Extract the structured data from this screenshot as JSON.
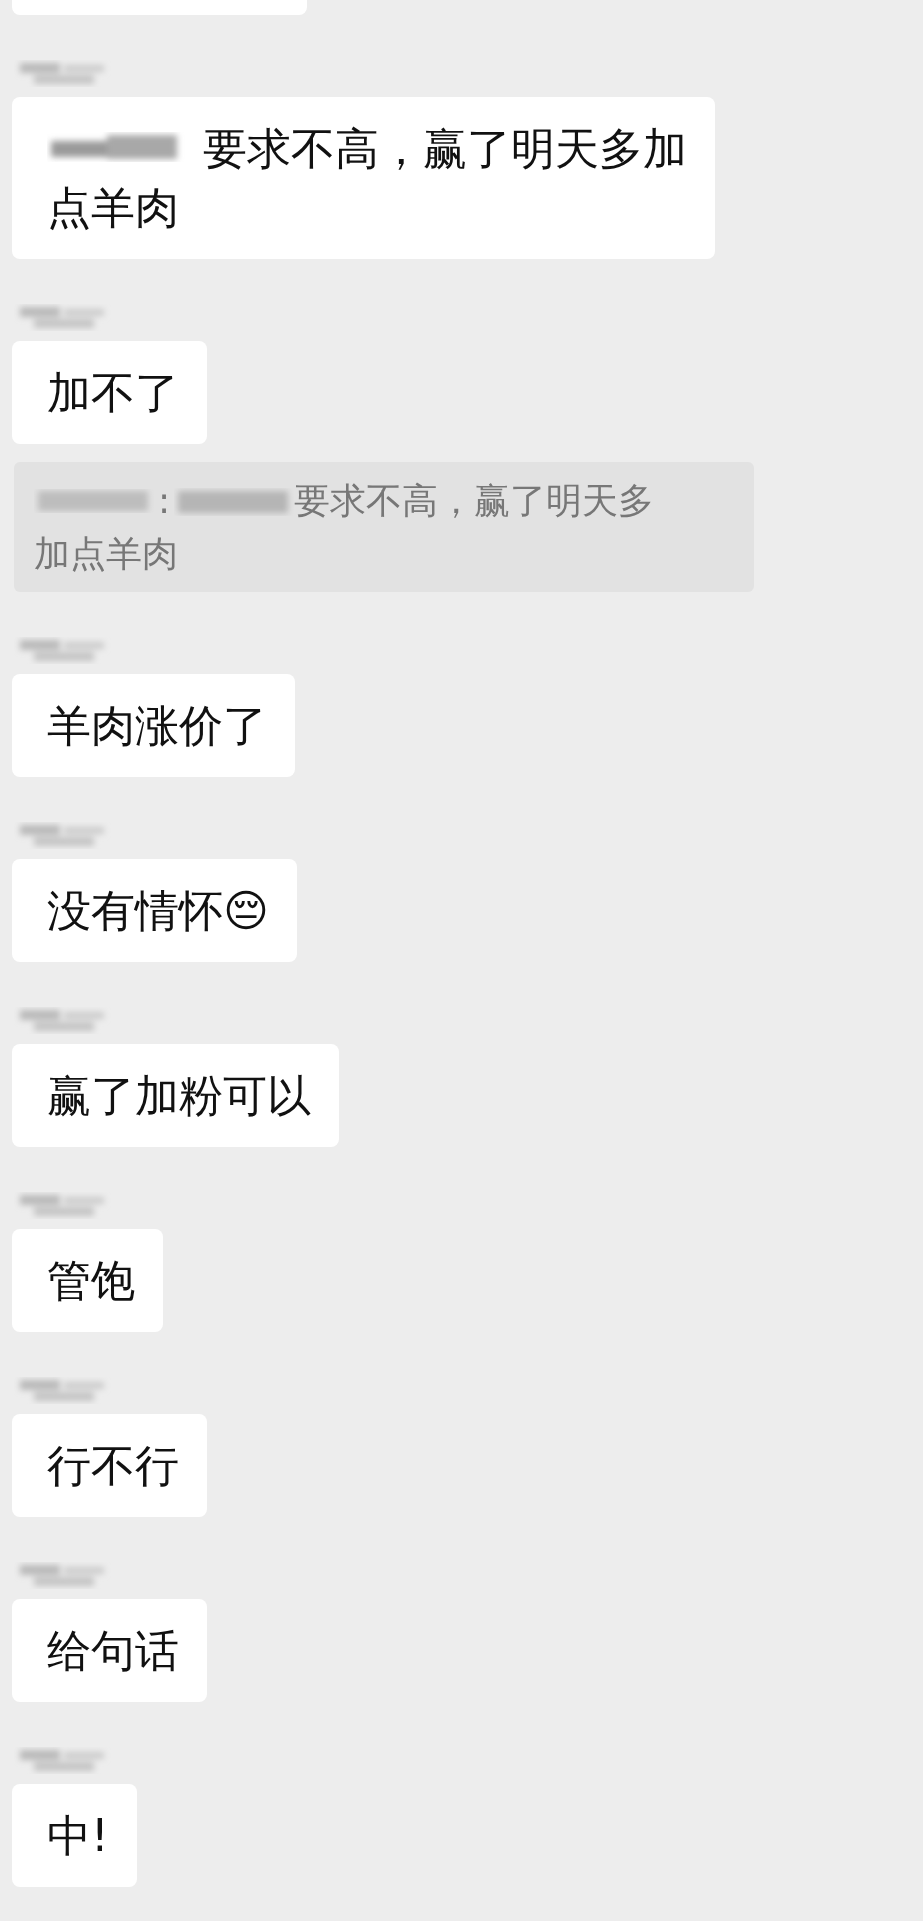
{
  "messages": [
    {
      "kind": "partial"
    },
    {
      "kind": "text",
      "mention": true,
      "lines": [
        "要求不高，赢了明天多加",
        "点羊肉"
      ]
    },
    {
      "kind": "text",
      "mention": false,
      "lines": [
        "加不了"
      ]
    },
    {
      "kind": "quote",
      "separator": ":",
      "lines": [
        "要求不高，赢了明天多",
        "加点羊肉"
      ]
    },
    {
      "kind": "text",
      "mention": false,
      "lines": [
        "羊肉涨价了"
      ]
    },
    {
      "kind": "text",
      "mention": false,
      "lines": [
        "没有情怀😔"
      ]
    },
    {
      "kind": "text",
      "mention": false,
      "lines": [
        "赢了加粉可以"
      ]
    },
    {
      "kind": "text",
      "mention": false,
      "lines": [
        "管饱"
      ]
    },
    {
      "kind": "text",
      "mention": false,
      "lines": [
        "行不行"
      ]
    },
    {
      "kind": "text",
      "mention": false,
      "lines": [
        "给句话"
      ]
    },
    {
      "kind": "text",
      "mention": false,
      "lines": [
        "中!"
      ]
    }
  ]
}
